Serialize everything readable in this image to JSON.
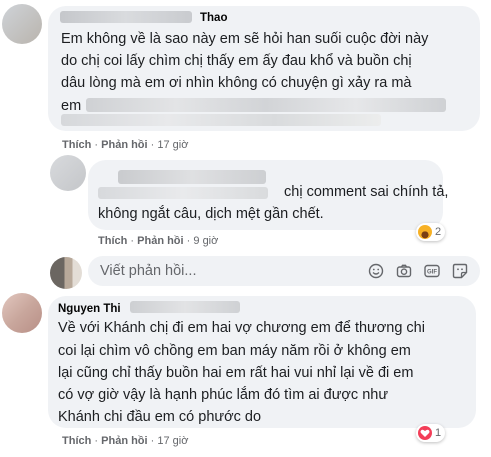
{
  "comments": [
    {
      "author": "Thao",
      "lines": [
        "Em không về là sao này em sẽ hỏi han suối cuộc đời này",
        "do chị coi lấy chìm chị thấy em ấy đau khổ và buồn chị",
        "dâu lòng mà em ơi nhìn không có chuyện gì xảy ra mà",
        "em"
      ],
      "like_label": "Thích",
      "reply_label": "Phản hồi",
      "time": "17 giờ"
    },
    {
      "author": "",
      "lines": [
        "chị comment sai chính tả,",
        "không ngắt câu, dịch mệt gần chết."
      ],
      "like_label": "Thích",
      "reply_label": "Phản hồi",
      "time": "9 giờ",
      "reaction_count": "2",
      "reaction_emoji": "haha"
    },
    {
      "author": "Nguyen Thi",
      "lines": [
        "Về với Khánh chị đi em hai vợ chương em để thương chi",
        "coi lại chìm vô chồng em ban máy năm rồi ở không em",
        "lại cũng chỉ thấy buồn hai em rất hai vui nhỉ lại về đi em",
        "có vợ giờ vậy là hạnh phúc lắm đó tìm ai được như",
        "Khánh chi đầu em có phước do"
      ],
      "like_label": "Thích",
      "reply_label": "Phản hồi",
      "time": "17 giờ",
      "reaction_count": "1",
      "reaction_emoji": "love"
    }
  ],
  "reply_box": {
    "placeholder": "Viết phản hồi...",
    "icons": [
      "emoji-icon",
      "camera-icon",
      "gif-icon",
      "sticker-icon"
    ]
  },
  "separator": "·",
  "colors": {
    "bubble": "#f0f2f5",
    "meta": "#65676b",
    "text": "#1c1e21",
    "haha": "#f7b125",
    "love": "#f33e58"
  }
}
